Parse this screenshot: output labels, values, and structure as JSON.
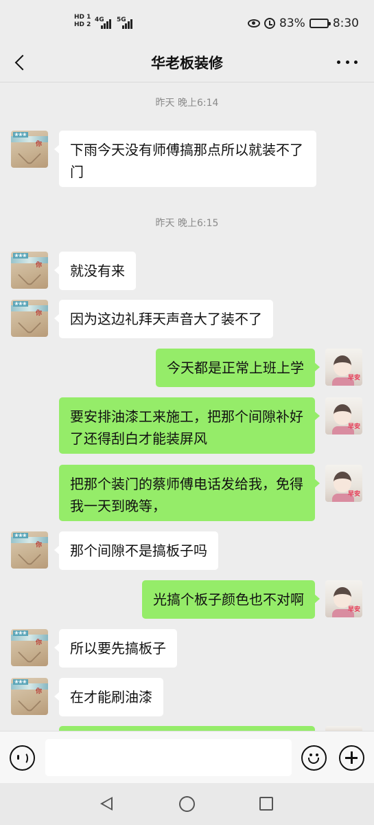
{
  "status_bar": {
    "hd1": "HD 1",
    "hd2": "HD 2",
    "net1": "4G",
    "net2": "5G",
    "battery_percent": "83%",
    "battery_level": 0.83,
    "time": "8:30"
  },
  "header": {
    "title": "华老板装修"
  },
  "chat": {
    "timestamps": [
      "昨天 晚上6:14",
      "昨天 晚上6:15"
    ],
    "messages": [
      {
        "from": "other",
        "text": "下雨今天没有师傅搞那点所以就装不了门"
      },
      {
        "from": "other",
        "text": "就没有来"
      },
      {
        "from": "other",
        "text": "因为这边礼拜天声音大了装不了"
      },
      {
        "from": "self",
        "text": "今天都是正常上班上学"
      },
      {
        "from": "self",
        "text": "要安排油漆工来施工，把那个间隙补好了还得刮白才能装屏风"
      },
      {
        "from": "self",
        "text": "把那个装门的蔡师傅电话发给我，免得我一天到晚等，"
      },
      {
        "from": "other",
        "text": "那个间隙不是搞板子吗"
      },
      {
        "from": "self",
        "text": "光搞个板子颜色也不对啊"
      },
      {
        "from": "other",
        "text": "所以要先搞板子"
      },
      {
        "from": "other",
        "text": "在才能刷油漆"
      }
    ],
    "avatar_other_text": "你",
    "avatar_self_text": "早安"
  },
  "input_bar": {
    "value": ""
  },
  "icons": {
    "back": "back-arrow-icon",
    "more": "more-dots-icon",
    "voice": "voice-icon",
    "emoji": "emoji-icon",
    "plus": "plus-icon"
  },
  "colors": {
    "outgoing_bubble": "#95ec69",
    "incoming_bubble": "#ffffff",
    "background": "#ededed"
  }
}
